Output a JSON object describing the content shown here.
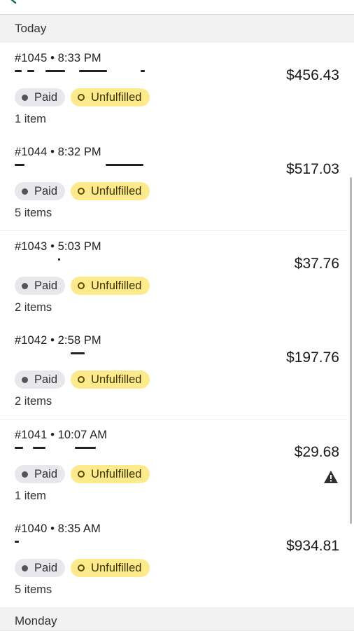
{
  "sections": [
    {
      "label": "Today"
    },
    {
      "label": "Monday"
    }
  ],
  "orders": [
    {
      "meta": "#1045 • 8:33 PM",
      "total": "$456.43",
      "payment": "Paid",
      "fulfillment": "Unfulfilled",
      "items": "1 item",
      "warning": false
    },
    {
      "meta": "#1044 • 8:32 PM",
      "total": "$517.03",
      "payment": "Paid",
      "fulfillment": "Unfulfilled",
      "items": "5 items",
      "warning": false
    },
    {
      "meta": "#1043 • 5:03 PM",
      "total": "$37.76",
      "payment": "Paid",
      "fulfillment": "Unfulfilled",
      "items": "2 items",
      "warning": false
    },
    {
      "meta": "#1042 • 2:58 PM",
      "total": "$197.76",
      "payment": "Paid",
      "fulfillment": "Unfulfilled",
      "items": "2 items",
      "warning": false
    },
    {
      "meta": "#1041 • 10:07 AM",
      "total": "$29.68",
      "payment": "Paid",
      "fulfillment": "Unfulfilled",
      "items": "1 item",
      "warning": true,
      "warning_icon": "alert-triangle-icon"
    },
    {
      "meta": "#1040 • 8:35 AM",
      "total": "$934.81",
      "payment": "Paid",
      "fulfillment": "Unfulfilled",
      "items": "5 items",
      "warning": false
    }
  ],
  "colors": {
    "section_bg": "#f2f2f2",
    "paid_badge": "#e8e8ec",
    "unfulfilled_badge": "#fdea8c",
    "back_chevron": "#1f6f4a"
  },
  "icons": {
    "back": "chevron-left-icon",
    "paid_status": "filled-dot-icon",
    "unfulfilled_status": "ring-dot-icon"
  }
}
